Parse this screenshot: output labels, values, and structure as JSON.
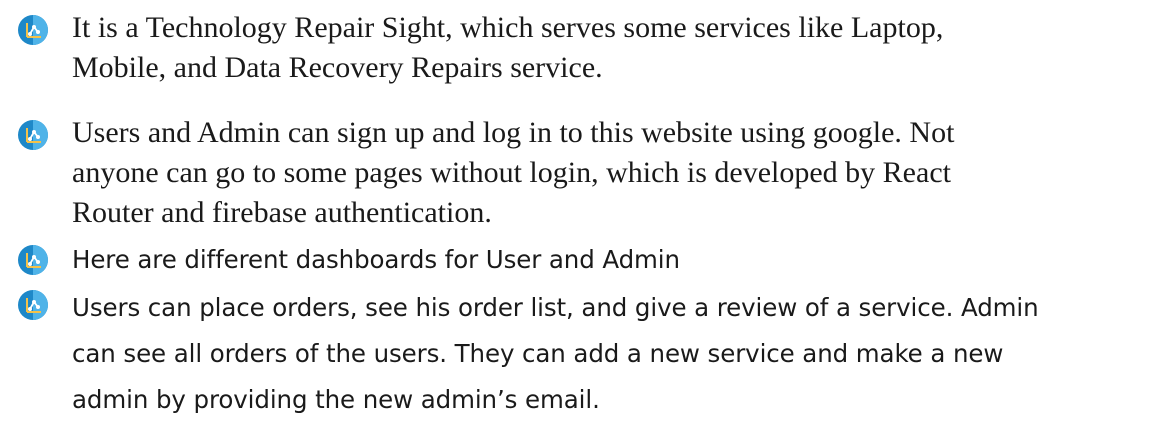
{
  "bullet_icon": "graph-icon",
  "colors": {
    "bullet_dark": "#1e88c8",
    "bullet_light": "#4fb3e8",
    "bullet_glyph": "#f4c24a"
  },
  "items": [
    {
      "lines": [
        "It is a Technology Repair Sight, which serves some services like Laptop,",
        "Mobile, and Data Recovery Repairs service."
      ]
    },
    {
      "lines": [
        "Users and Admin can sign up and log in to this website using google. Not",
        "anyone can go to some pages without login, which is developed by React",
        "Router and firebase authentication."
      ]
    },
    {
      "lines": [
        "Here are different dashboards for User and Admin"
      ]
    },
    {
      "lines": [
        "Users can place orders, see his order list, and give a review of a service. Admin",
        "can see all orders of the users. They can add a new service and make a new",
        "admin by providing the new admin’s email."
      ]
    }
  ]
}
